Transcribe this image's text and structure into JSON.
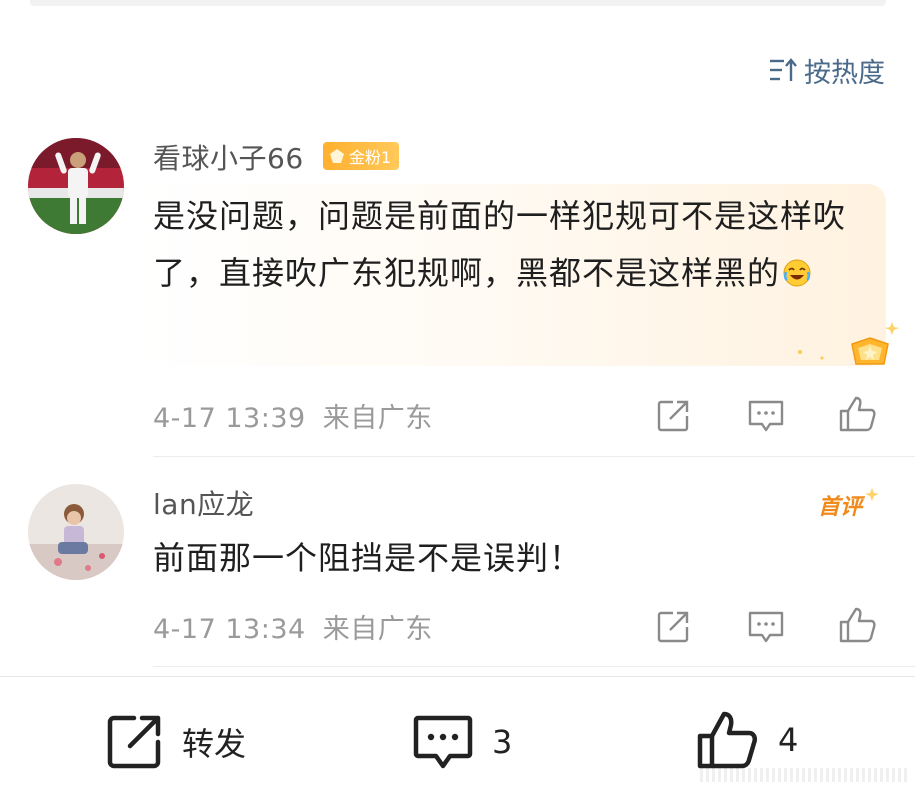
{
  "sort": {
    "label": "按热度",
    "icon": "sort-icon"
  },
  "comments": [
    {
      "username": "看球小子66",
      "badge": "金粉1",
      "text": "是没问题，问题是前面的一样犯规可不是这样吹了，直接吹广东犯规啊，黑都不是这样黑的",
      "emoji": "laugh-cry-emoji",
      "time": "4-17 13:39",
      "location": "来自广东"
    },
    {
      "username": "lan应龙",
      "tag": "首评",
      "text": "前面那一个阻挡是不是误判！",
      "time": "4-17 13:34",
      "location": "来自广东"
    }
  ],
  "bottom": {
    "repost_label": "转发",
    "comment_count": "3",
    "like_count": "4"
  },
  "colors": {
    "accent_gold": "#ffb02e",
    "meta_gray": "#9a9a9a",
    "sort_blue": "#4a6a8a",
    "hot_orange": "#f08a1a"
  }
}
